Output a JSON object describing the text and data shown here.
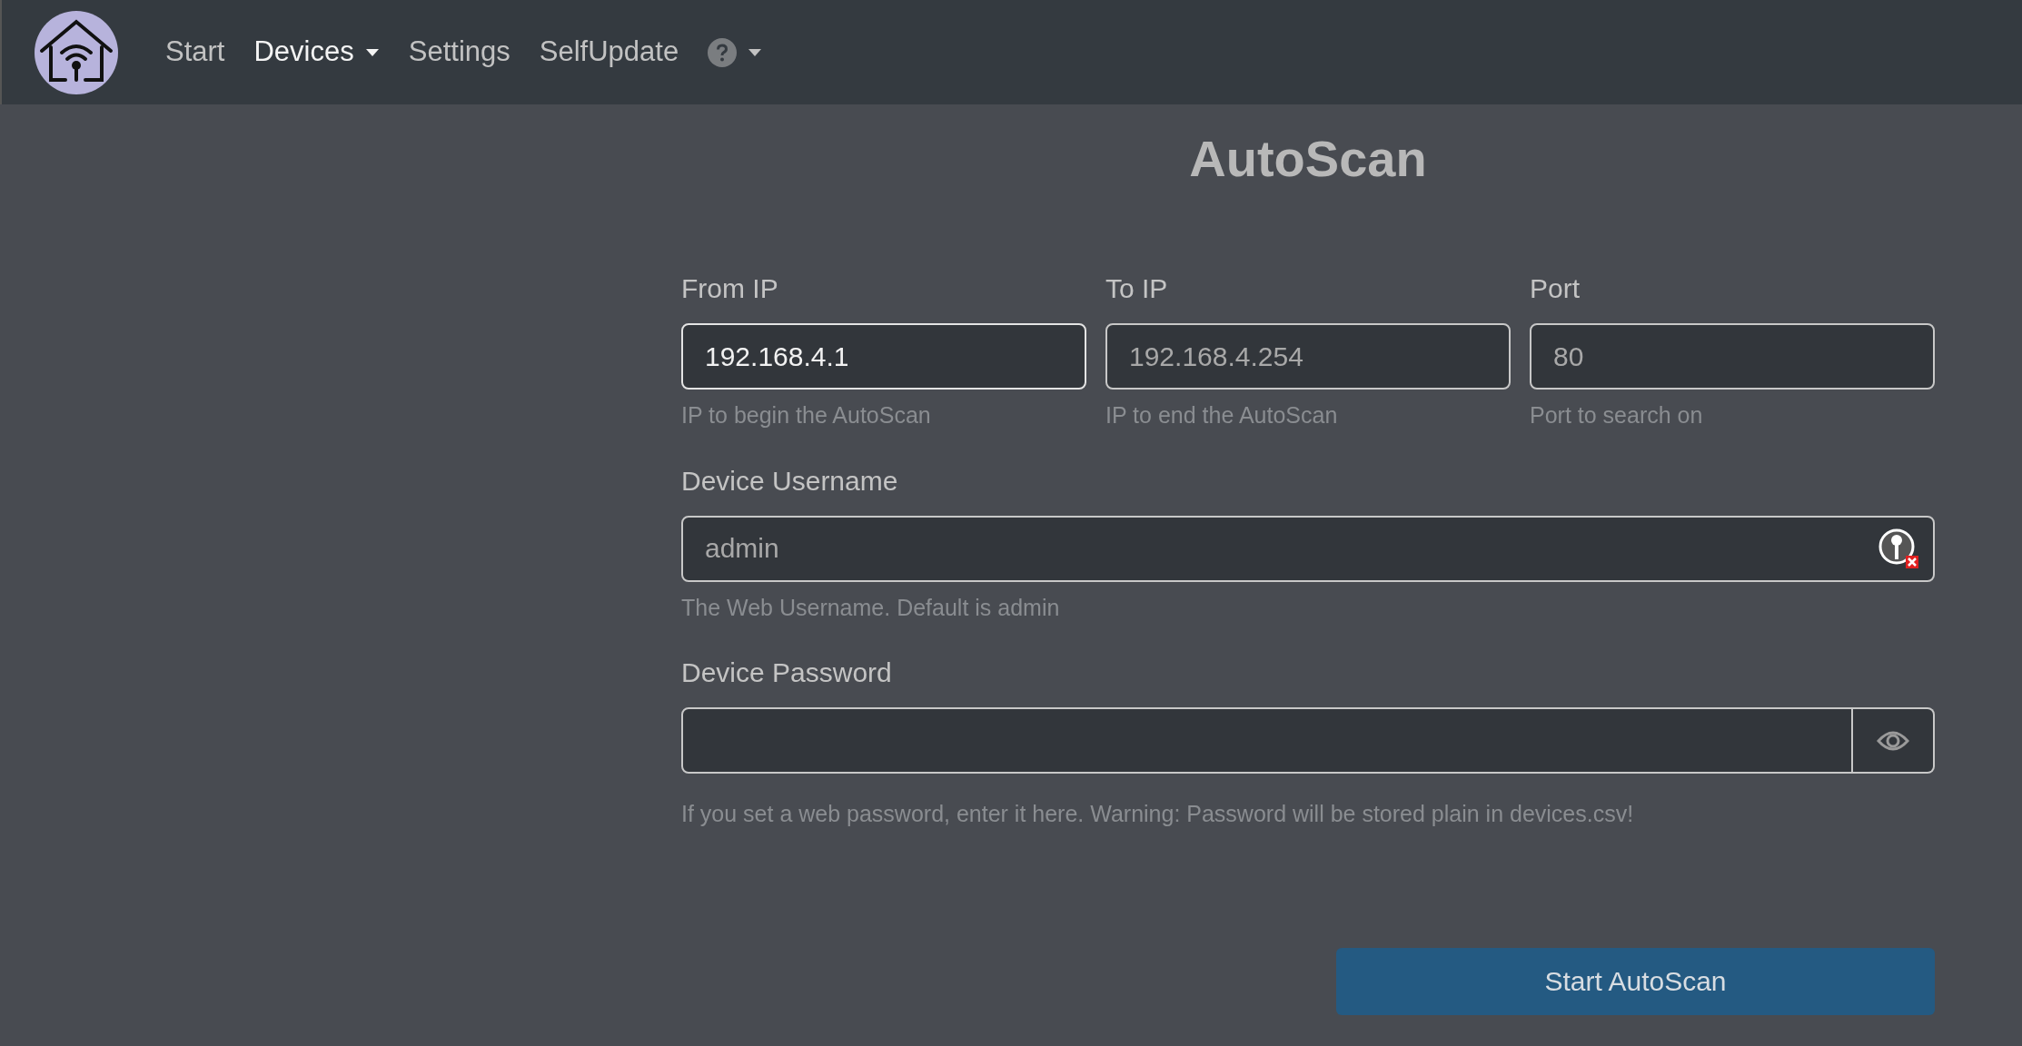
{
  "navbar": {
    "items": [
      {
        "label": "Start",
        "selected": false,
        "dropdown": false
      },
      {
        "label": "Devices",
        "selected": true,
        "dropdown": true
      },
      {
        "label": "Settings",
        "selected": false,
        "dropdown": false
      },
      {
        "label": "SelfUpdate",
        "selected": false,
        "dropdown": false
      }
    ],
    "help_menu": {
      "dropdown": true
    }
  },
  "title": "AutoScan",
  "ip_fields": [
    {
      "label": "From IP",
      "value": "192.168.4.1",
      "focused": true,
      "hint": "IP to begin the AutoScan"
    },
    {
      "label": "To IP",
      "placeholder": "192.168.4.254",
      "focused": false,
      "hint": "IP to end the AutoScan"
    },
    {
      "label": "Port",
      "placeholder": "80",
      "focused": false,
      "hint": "Port to search on"
    }
  ],
  "username": {
    "label": "Device Username",
    "placeholder": "admin",
    "hint": "The Web Username. Default is admin"
  },
  "password": {
    "label": "Device Password",
    "hint": "If you set a web password, enter it here. Warning: Password will be stored plain in devices.csv!"
  },
  "button": "Start AutoScan"
}
